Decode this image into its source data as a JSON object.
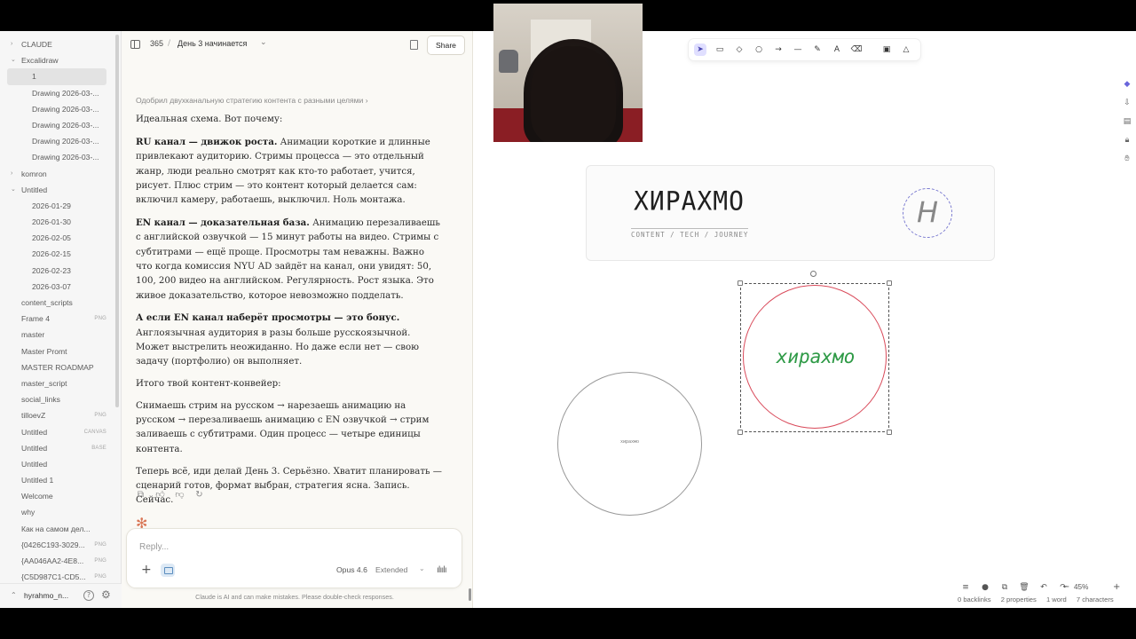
{
  "sidebar": {
    "items": [
      {
        "label": "CLAUDE",
        "kind": "folder",
        "open": false
      },
      {
        "label": "Excalidraw",
        "kind": "folder",
        "open": true
      },
      {
        "label": "1",
        "kind": "file",
        "selected": true
      },
      {
        "label": "Drawing 2026-03-...",
        "kind": "file"
      },
      {
        "label": "Drawing 2026-03-...",
        "kind": "file"
      },
      {
        "label": "Drawing 2026-03-...",
        "kind": "file"
      },
      {
        "label": "Drawing 2026-03-...",
        "kind": "file"
      },
      {
        "label": "Drawing 2026-03-...",
        "kind": "file"
      },
      {
        "label": "komron",
        "kind": "folder",
        "open": false
      },
      {
        "label": "Untitled",
        "kind": "folder",
        "open": true
      },
      {
        "label": "2026-01-29",
        "kind": "file"
      },
      {
        "label": "2026-01-30",
        "kind": "file"
      },
      {
        "label": "2026-02-05",
        "kind": "file"
      },
      {
        "label": "2026-02-15",
        "kind": "file"
      },
      {
        "label": "2026-02-23",
        "kind": "file"
      },
      {
        "label": "2026-03-07",
        "kind": "file"
      },
      {
        "label": "content_scripts",
        "kind": "root"
      },
      {
        "label": "Frame 4",
        "kind": "root",
        "badge": "PNG"
      },
      {
        "label": "master",
        "kind": "root"
      },
      {
        "label": "Master Promt",
        "kind": "root"
      },
      {
        "label": "MASTER ROADMAP",
        "kind": "root"
      },
      {
        "label": "master_script",
        "kind": "root"
      },
      {
        "label": "social_links",
        "kind": "root"
      },
      {
        "label": "tilloevZ",
        "kind": "root",
        "badge": "PNG"
      },
      {
        "label": "Untitled",
        "kind": "root",
        "badge": "CANVAS"
      },
      {
        "label": "Untitled",
        "kind": "root",
        "badge": "BASE"
      },
      {
        "label": "Untitled",
        "kind": "root"
      },
      {
        "label": "Untitled 1",
        "kind": "root"
      },
      {
        "label": "Welcome",
        "kind": "root"
      },
      {
        "label": "why",
        "kind": "root"
      },
      {
        "label": "Как на самом дел...",
        "kind": "root"
      },
      {
        "label": "{0426C193-3029...",
        "kind": "top",
        "badge": "PNG"
      },
      {
        "label": "{AA046AA2-4E8...",
        "kind": "top",
        "badge": "PNG"
      },
      {
        "label": "{C5D987C1-CD5...",
        "kind": "top",
        "badge": "PNG"
      }
    ],
    "vault_name": "hyrahmo_n..."
  },
  "chat": {
    "project": "365",
    "title": "День 3 начинается",
    "share_label": "Share",
    "thinking": "Одобрил двухканальную стратегию контента с разными целями ›",
    "paragraphs": [
      {
        "bold": "",
        "text": "Идеальная схема. Вот почему:"
      },
      {
        "bold": "RU канал — движок роста.",
        "text": " Анимации короткие и длинные привлекают аудиторию. Стримы процесса — это отдельный жанр, люди реально смотрят как кто-то работает, учится, рисует. Плюс стрим — это контент который делается сам: включил камеру, работаешь, выключил. Ноль монтажа."
      },
      {
        "bold": "EN канал — доказательная база.",
        "text": " Анимацию перезаливаешь с английской озвучкой — 15 минут работы на видео. Стримы с субтитрами — ещё проще. Просмотры там неважны. Важно что когда комиссия NYU AD зайдёт на канал, они увидят: 50, 100, 200 видео на английском. Регулярность. Рост языка. Это живое доказательство, которое невозможно подделать."
      },
      {
        "bold": "А если EN канал наберёт просмотры — это бонус.",
        "text": " Англоязычная аудитория в разы больше русскоязычной. Может выстрелить неожиданно. Но даже если нет — свою задачу (портфолио) он выполняет."
      },
      {
        "bold": "",
        "text": "Итого твой контент-конвейер:"
      },
      {
        "bold": "",
        "text": "Снимаешь стрим на русском → нарезаешь анимацию на русском → перезаливаешь анимацию с EN озвучкой → стрим заливаешь с субтитрами. Один процесс — четыре единицы контента."
      },
      {
        "bold": "",
        "text": "Теперь всё, иди делай День 3. Серьёзно. Хватит планировать — сценарий готов, формат выбран, стратегия ясна. Запись. Сейчас."
      }
    ],
    "composer": {
      "placeholder": "Reply...",
      "model": "Opus 4.6",
      "mode": "Extended"
    },
    "disclaimer": "Claude is AI and can make mistakes. Please double-check responses."
  },
  "canvas": {
    "banner_title": "ХИРАХМО",
    "banner_tagline": "CONTENT / TECH / JOURNEY",
    "banner_logo_letter": "H",
    "selected_circle_text": "хирахмо",
    "small_circle_text": "хирахмо",
    "zoom": "45%",
    "status": {
      "backlinks": "0 backlinks",
      "properties": "2 properties",
      "words": "1 word",
      "characters": "7 characters"
    },
    "colors": {
      "accent": "#6965db",
      "circle_stroke": "#d94a5a",
      "circle_text": "#2e9a46"
    }
  }
}
